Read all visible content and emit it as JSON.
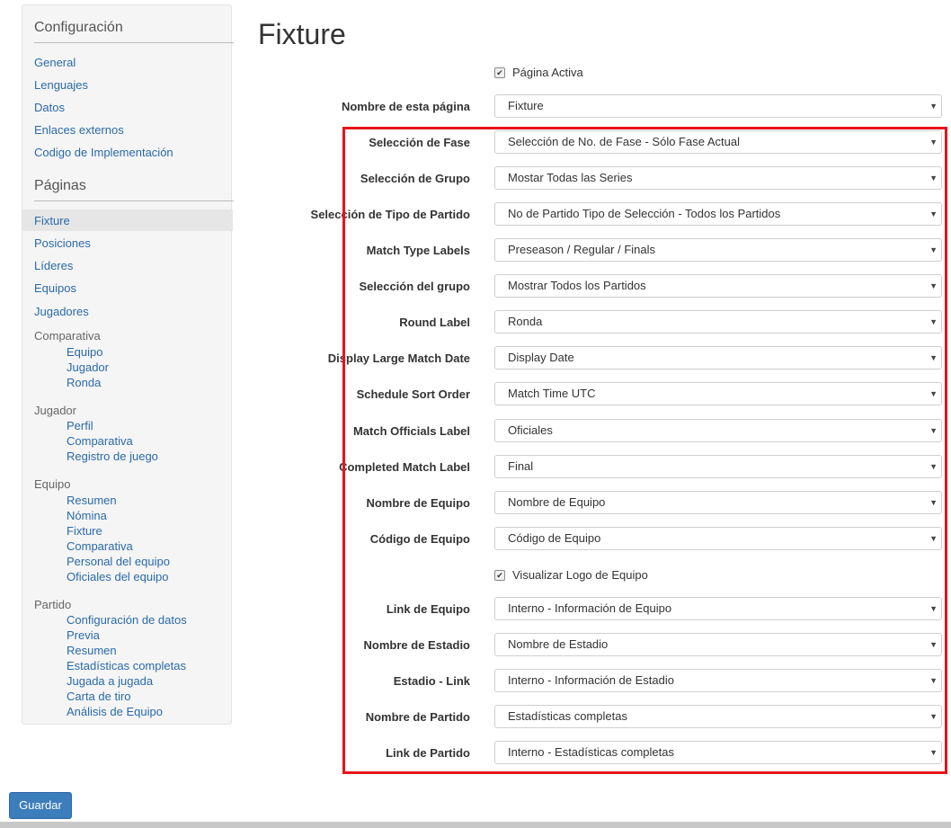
{
  "sidebar": {
    "config_heading": "Configuración",
    "config_links": [
      "General",
      "Lenguajes",
      "Datos",
      "Enlaces externos",
      "Codigo de Implementación"
    ],
    "pages_heading": "Páginas",
    "page_links": [
      "Fixture",
      "Posiciones",
      "Líderes",
      "Equipos",
      "Jugadores"
    ],
    "active_page": "Fixture",
    "groups": [
      {
        "label": "Comparativa",
        "items": [
          "Equipo",
          "Jugador",
          "Ronda"
        ]
      },
      {
        "label": "Jugador",
        "items": [
          "Perfil",
          "Comparativa",
          "Registro de juego"
        ]
      },
      {
        "label": "Equipo",
        "items": [
          "Resumen",
          "Nómina",
          "Fixture",
          "Comparativa",
          "Personal del equipo",
          "Oficiales del equipo"
        ]
      },
      {
        "label": "Partido",
        "items": [
          "Configuración de datos",
          "Previa",
          "Resumen",
          "Estadísticas completas",
          "Jugada a jugada",
          "Carta de tiro",
          "Análisis de Equipo"
        ]
      }
    ]
  },
  "main": {
    "title": "Fixture",
    "active_checkbox": {
      "label": "Página Activa",
      "checked": true
    },
    "page_name": {
      "label": "Nombre de esta página",
      "value": "Fixture"
    },
    "fields": [
      {
        "label": "Selección de Fase",
        "value": "Selección de No. de Fase - Sólo Fase Actual"
      },
      {
        "label": "Selección de Grupo",
        "value": "Mostar Todas las Series"
      },
      {
        "label": "Selección de Tipo de Partido",
        "value": "No de Partido Tipo de Selección - Todos los Partidos"
      },
      {
        "label": "Match Type Labels",
        "value": "Preseason / Regular / Finals"
      },
      {
        "label": "Selección del grupo",
        "value": "Mostrar Todos los Partidos"
      },
      {
        "label": "Round Label",
        "value": "Ronda"
      },
      {
        "label": "Display Large Match Date",
        "value": "Display Date"
      },
      {
        "label": "Schedule Sort Order",
        "value": "Match Time UTC"
      },
      {
        "label": "Match Officials Label",
        "value": "Oficiales"
      },
      {
        "label": "Completed Match Label",
        "value": "Final"
      },
      {
        "label": "Nombre de Equipo",
        "value": "Nombre de Equipo"
      },
      {
        "label": "Código de Equipo",
        "value": "Código de Equipo"
      }
    ],
    "logo_checkbox": {
      "label": "Visualizar Logo de Equipo",
      "checked": true
    },
    "fields2": [
      {
        "label": "Link de Equipo",
        "value": "Interno - Información de Equipo"
      },
      {
        "label": "Nombre de Estadio",
        "value": "Nombre de Estadio"
      },
      {
        "label": "Estadio - Link",
        "value": "Interno - Información de Estadio"
      },
      {
        "label": "Nombre de Partido",
        "value": "Estadísticas completas"
      },
      {
        "label": "Link de Partido",
        "value": "Interno - Estadísticas completas"
      }
    ],
    "save_label": "Guardar",
    "highlight_color": "#e8141b",
    "accent_color": "#3c7dbc",
    "link_color": "#2a6aa8",
    "dropdown_icon": "chevron-down-icon",
    "checkbox_icon": "checkmark-icon"
  }
}
